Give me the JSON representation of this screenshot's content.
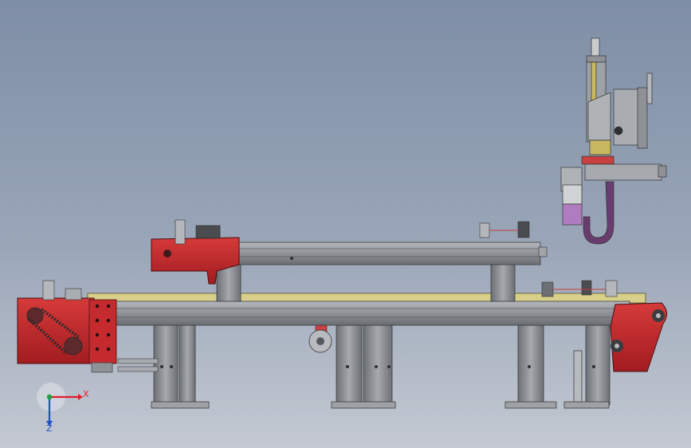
{
  "viewport": {
    "background_top": "#7e8ea6",
    "background_bottom": "#c4c9d2"
  },
  "colors": {
    "frame_red": "#c0252a",
    "profile_grey": "#8e9196",
    "profile_dark": "#5e6166",
    "rail_yellow": "#c8b860",
    "purple_block": "#b07cc0",
    "hook_purple": "#6a3c6e"
  },
  "triad": {
    "x_label": "X",
    "z_label": "Z",
    "x_color": "#e0202a",
    "z_color": "#2050c8",
    "y_color": "#20a040"
  }
}
